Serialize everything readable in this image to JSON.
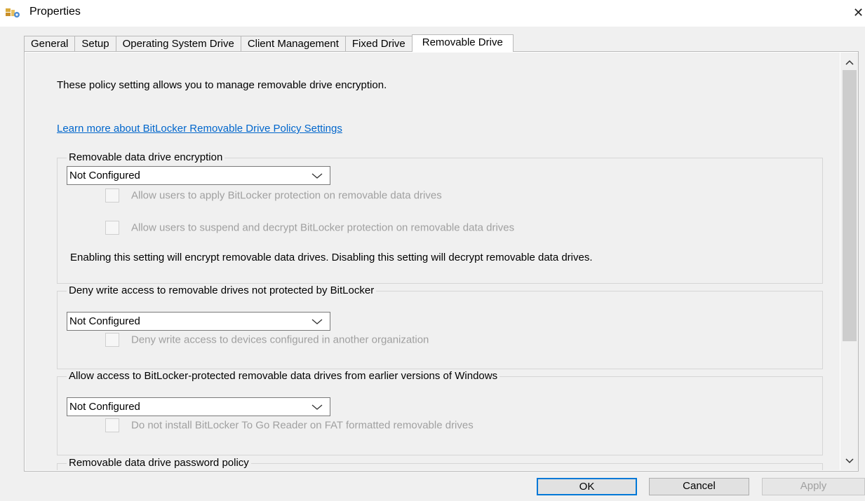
{
  "window": {
    "title": "Properties",
    "close_glyph": "✕"
  },
  "tabs": [
    {
      "label": "General"
    },
    {
      "label": "Setup"
    },
    {
      "label": "Operating System Drive"
    },
    {
      "label": "Client Management"
    },
    {
      "label": "Fixed Drive"
    },
    {
      "label": "Removable Drive",
      "active": true
    }
  ],
  "intro": "These policy setting allows you to manage removable drive encryption.",
  "learn_more_link": "Learn more about BitLocker Removable Drive Policy Settings",
  "groups": [
    {
      "title": "Removable data drive encryption",
      "dropdown_value": "Not Configured",
      "checkboxes": [
        {
          "label": "Allow users to apply BitLocker protection on removable data drives",
          "checked": false,
          "enabled": false
        },
        {
          "label": "Allow users to suspend and decrypt BitLocker protection on removable data drives",
          "checked": false,
          "enabled": false
        }
      ],
      "description": "Enabling this setting will encrypt removable data drives. Disabling this setting will decrypt removable data drives."
    },
    {
      "title": "Deny write access to removable drives not protected by BitLocker",
      "dropdown_value": "Not Configured",
      "checkboxes": [
        {
          "label": "Deny write access to devices configured in another organization",
          "checked": false,
          "enabled": false
        }
      ]
    },
    {
      "title": "Allow access to BitLocker-protected removable data drives from earlier versions of Windows",
      "dropdown_value": "Not Configured",
      "checkboxes": [
        {
          "label": "Do not install BitLocker To Go Reader on FAT formatted removable drives",
          "checked": false,
          "enabled": false
        }
      ]
    },
    {
      "title": "Removable data drive password policy"
    }
  ],
  "buttons": {
    "ok": "OK",
    "cancel": "Cancel",
    "apply": "Apply"
  },
  "icons": {
    "app": "properties-icon",
    "close": "close-icon",
    "scroll_up": "chevron-up-icon",
    "scroll_down": "chevron-down-icon",
    "dropdown": "chevron-down-icon"
  },
  "colors": {
    "link": "#0066cc",
    "default_button_border": "#0078d7",
    "disabled_text": "#a0a0a0"
  }
}
